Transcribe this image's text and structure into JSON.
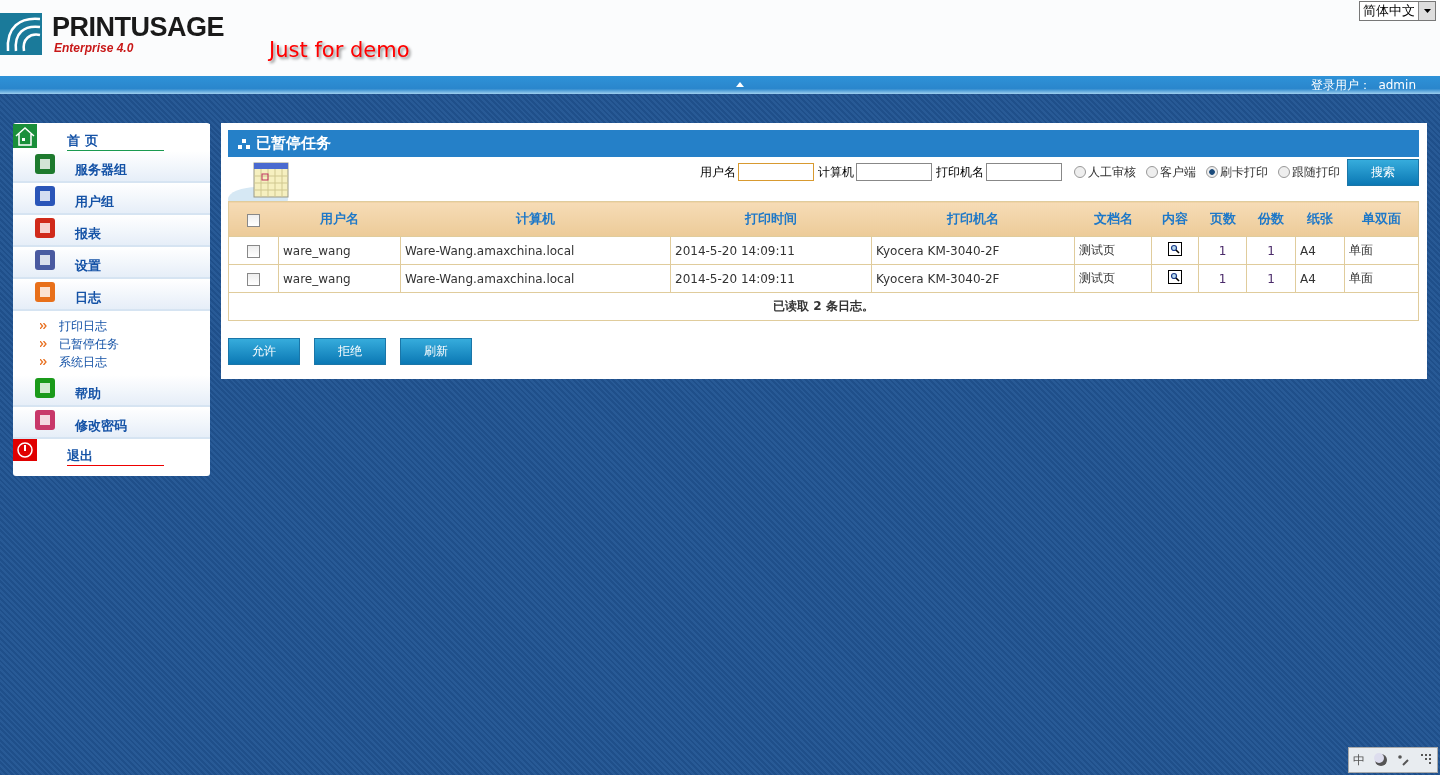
{
  "header": {
    "logo_name": "PRINTUSAGE",
    "logo_edition": "Enterprise 4.0",
    "demo_note": "Just for demo",
    "language": "简体中文"
  },
  "top_bar": {
    "user_label": "登录用户：",
    "user": "admin"
  },
  "sidebar": {
    "items": [
      {
        "label": "首 页",
        "kind": "home"
      },
      {
        "label": "服务器组",
        "kind": "section"
      },
      {
        "label": "用户组",
        "kind": "section"
      },
      {
        "label": "报表",
        "kind": "section"
      },
      {
        "label": "设置",
        "kind": "section"
      },
      {
        "label": "日志",
        "kind": "section",
        "children": [
          {
            "label": "打印日志"
          },
          {
            "label": "已暂停任务"
          },
          {
            "label": "系统日志"
          }
        ]
      },
      {
        "label": "帮助",
        "kind": "section"
      },
      {
        "label": "修改密码",
        "kind": "section"
      },
      {
        "label": "退出",
        "kind": "exit"
      }
    ]
  },
  "panel": {
    "title": "已暂停任务",
    "filters": [
      {
        "label": "用户名",
        "focused": true
      },
      {
        "label": "计算机",
        "focused": false
      },
      {
        "label": "打印机名",
        "focused": false
      }
    ],
    "modes": [
      {
        "label": "人工审核",
        "selected": false
      },
      {
        "label": "客户端",
        "selected": false
      },
      {
        "label": "刷卡打印",
        "selected": true
      },
      {
        "label": "跟随打印",
        "selected": false
      }
    ],
    "search_button": "搜索",
    "table": {
      "header_checked": false,
      "columns": [
        "用户名",
        "计算机",
        "打印时间",
        "打印机名",
        "文档名",
        "内容",
        "页数",
        "份数",
        "纸张",
        "单双面"
      ],
      "rows": [
        {
          "checked": false,
          "user": "ware_wang",
          "computer": "Ware-Wang.amaxchina.local",
          "time": "2014-5-20 14:09:11",
          "printer": "Kyocera KM-3040-2F",
          "document": "测试页",
          "pages": "1",
          "copies": "1",
          "paper": "A4",
          "duplex": "单面"
        },
        {
          "checked": false,
          "user": "ware_wang",
          "computer": "Ware-Wang.amaxchina.local",
          "time": "2014-5-20 14:09:11",
          "printer": "Kyocera KM-3040-2F",
          "document": "测试页",
          "pages": "1",
          "copies": "1",
          "paper": "A4",
          "duplex": "单面"
        }
      ],
      "footer": "已读取 2 条日志。"
    },
    "buttons": [
      "允许",
      "拒绝",
      "刷新"
    ]
  },
  "ime_bar": {
    "mode": "中"
  }
}
